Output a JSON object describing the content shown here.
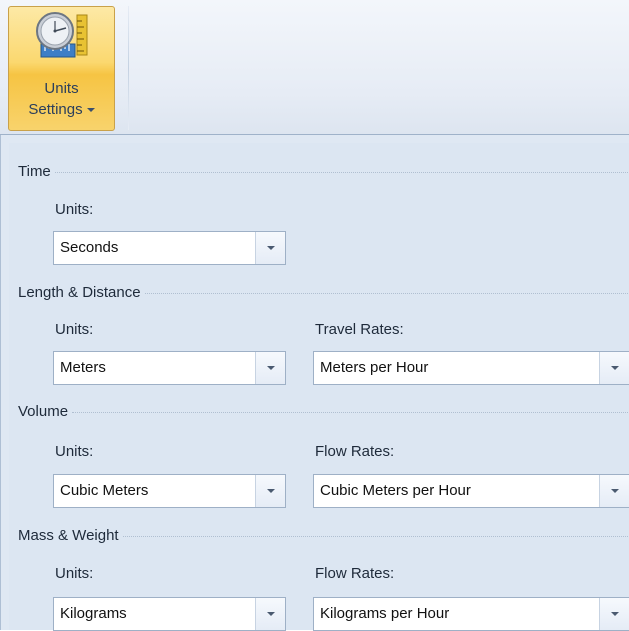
{
  "ribbon": {
    "button": {
      "line1": "Units",
      "line2": "Settings",
      "icon": "clock-ruler-icon"
    }
  },
  "groups": {
    "time": {
      "title": "Time",
      "units_label": "Units:",
      "units_value": "Seconds"
    },
    "length": {
      "title": "Length & Distance",
      "units_label": "Units:",
      "units_value": "Meters",
      "rates_label": "Travel Rates:",
      "rates_value": "Meters per Hour"
    },
    "volume": {
      "title": "Volume",
      "units_label": "Units:",
      "units_value": "Cubic Meters",
      "rates_label": "Flow Rates:",
      "rates_value": "Cubic Meters per Hour"
    },
    "mass": {
      "title": "Mass & Weight",
      "units_label": "Units:",
      "units_value": "Kilograms",
      "rates_label": "Flow Rates:",
      "rates_value": "Kilograms per Hour"
    }
  },
  "colors": {
    "ribbon_active": "#f8d36c",
    "panel_bg": "#dfe8f3",
    "text": "#1e2a3a"
  }
}
